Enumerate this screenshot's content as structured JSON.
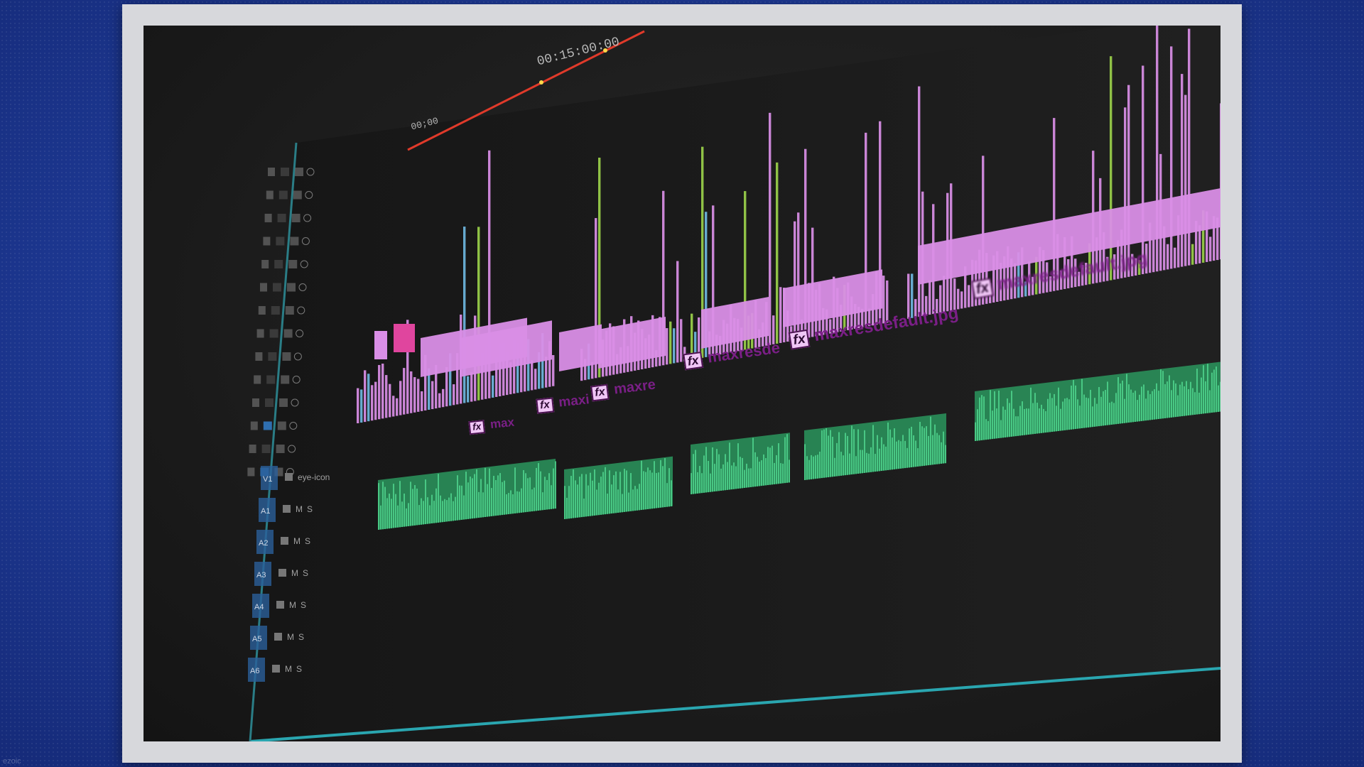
{
  "frame": {
    "background_color": "#1f3b97",
    "border_color": "#d7d8dc"
  },
  "timeline": {
    "timecode": "00:15:00:00",
    "ruler_label": "00;00",
    "video_clip_color": "#d98ee6",
    "audio_clip_color": "#4fd38d",
    "playhead_color": "#e03a2a",
    "video_clips": [
      {
        "fx": "fx",
        "label": "max"
      },
      {
        "fx": "fx",
        "label": "maxi"
      },
      {
        "fx": "fx",
        "label": "maxre"
      },
      {
        "fx": "fx",
        "label": "maxresde"
      },
      {
        "fx": "fx",
        "label": "maxresdefault.jpg"
      },
      {
        "fx": "fx",
        "label": "maxresdefault.jpg"
      }
    ],
    "track_headers": [
      {
        "name": "V1",
        "controls": [
          "lock-icon",
          "eye-icon"
        ]
      },
      {
        "name": "A1",
        "controls": [
          "lock-icon",
          "M",
          "S"
        ]
      },
      {
        "name": "A2",
        "controls": [
          "lock-icon",
          "M",
          "S"
        ]
      },
      {
        "name": "A3",
        "controls": [
          "lock-icon",
          "M",
          "S"
        ]
      },
      {
        "name": "A4",
        "controls": [
          "lock-icon",
          "M",
          "S"
        ]
      },
      {
        "name": "A5",
        "controls": [
          "lock-icon",
          "M",
          "S"
        ]
      },
      {
        "name": "A6",
        "controls": [
          "lock-icon",
          "M",
          "S"
        ]
      }
    ]
  }
}
